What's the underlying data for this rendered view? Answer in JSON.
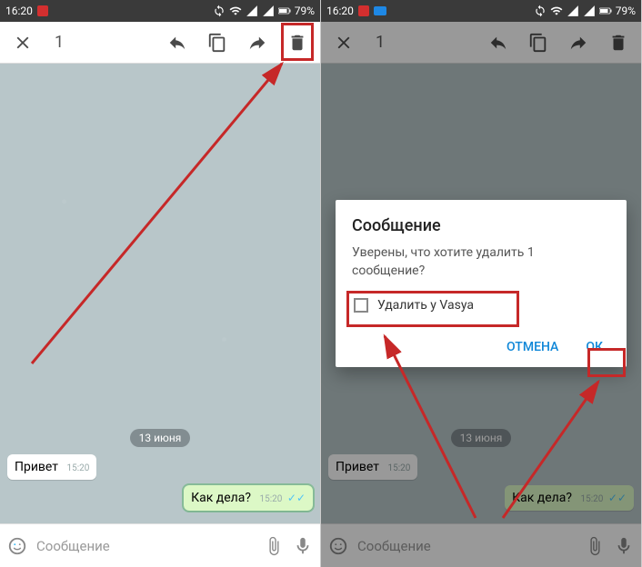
{
  "status": {
    "time": "16:20",
    "battery": "79%"
  },
  "toolbar": {
    "selected_count": "1"
  },
  "chat": {
    "date": "13 июня",
    "msg_in": "Привет",
    "msg_in_time": "15:20",
    "msg_out": "Как дела?",
    "msg_out_time": "15:20"
  },
  "input": {
    "placeholder": "Сообщение"
  },
  "dialog": {
    "title": "Сообщение",
    "body": "Уверены, что хотите удалить 1 сообщение?",
    "checkbox_label": "Удалить у Vasya",
    "cancel": "ОТМЕНА",
    "ok": "ОК"
  }
}
